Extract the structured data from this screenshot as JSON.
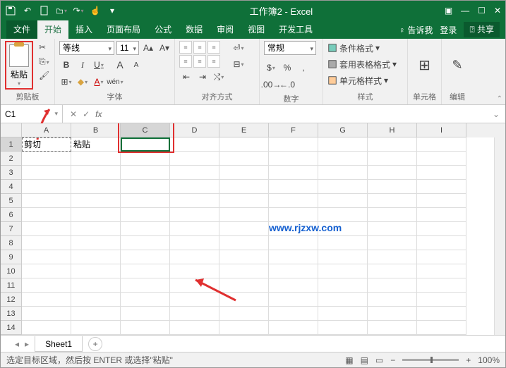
{
  "title": "工作簿2 - Excel",
  "tabs": {
    "file": "文件",
    "home": "开始",
    "insert": "插入",
    "layout": "页面布局",
    "formula": "公式",
    "data": "数据",
    "review": "审阅",
    "view": "视图",
    "dev": "开发工具"
  },
  "tell_me": "告诉我",
  "login": "登录",
  "share": "共享",
  "ribbon": {
    "clipboard": {
      "paste": "粘贴",
      "label": "剪贴板"
    },
    "font": {
      "family": "等线",
      "size": "11",
      "label": "字体",
      "wen": "wén"
    },
    "align": {
      "label": "对齐方式"
    },
    "number": {
      "format": "常规",
      "label": "数字"
    },
    "styles": {
      "cond": "条件格式",
      "table": "套用表格格式",
      "cell": "单元格样式",
      "label": "样式"
    },
    "cells": {
      "label": "单元格"
    },
    "edit": {
      "label": "编辑"
    }
  },
  "namebox": "C1",
  "columns": [
    "A",
    "B",
    "C",
    "D",
    "E",
    "F",
    "G",
    "H",
    "I"
  ],
  "rows": [
    "1",
    "2",
    "3",
    "4",
    "5",
    "6",
    "7",
    "8",
    "9",
    "10",
    "11",
    "12",
    "13",
    "14"
  ],
  "cells": {
    "A1": "剪切",
    "B1": "粘贴"
  },
  "watermark": "www.rjzxw.com",
  "sheet": "Sheet1",
  "status": "选定目标区域，然后按 ENTER 或选择\"粘贴\"",
  "zoom": "100%"
}
